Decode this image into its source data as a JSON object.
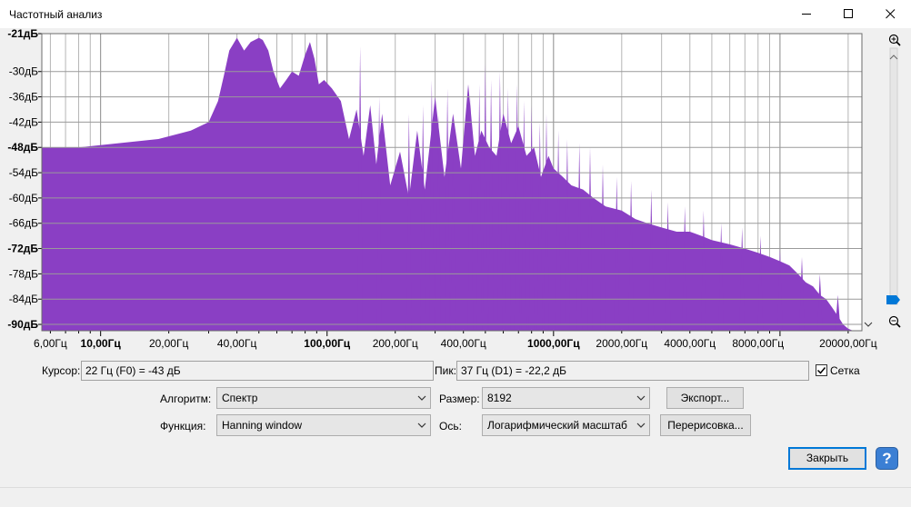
{
  "window": {
    "title": "Частотный анализ"
  },
  "chart_data": {
    "type": "area",
    "title": "",
    "xlabel": "",
    "ylabel": "",
    "x_scale": "log",
    "xlim": [
      5.5,
      23000
    ],
    "ylim": [
      -91.5,
      -21
    ],
    "grid": true,
    "color": "#8a3fc4",
    "y_ticks": [
      {
        "value": -21,
        "label": "-21дБ",
        "bold": true
      },
      {
        "value": -30,
        "label": "-30дБ"
      },
      {
        "value": -36,
        "label": "-36дБ"
      },
      {
        "value": -42,
        "label": "-42дБ"
      },
      {
        "value": -48,
        "label": "-48дБ",
        "bold": true
      },
      {
        "value": -54,
        "label": "-54дБ"
      },
      {
        "value": -60,
        "label": "-60дБ"
      },
      {
        "value": -66,
        "label": "-66дБ"
      },
      {
        "value": -72,
        "label": "-72дБ",
        "bold": true
      },
      {
        "value": -78,
        "label": "-78дБ"
      },
      {
        "value": -84,
        "label": "-84дБ"
      },
      {
        "value": -90,
        "label": "-90дБ",
        "bold": true
      }
    ],
    "x_ticks": [
      {
        "value": 6,
        "label": "6,00Гц"
      },
      {
        "value": 10,
        "label": "10,00Гц",
        "bold": true
      },
      {
        "value": 20,
        "label": "20,00Гц"
      },
      {
        "value": 40,
        "label": "40,00Гц"
      },
      {
        "value": 100,
        "label": "100,00Гц",
        "bold": true
      },
      {
        "value": 200,
        "label": "200,00Гц"
      },
      {
        "value": 400,
        "label": "400,00Гц"
      },
      {
        "value": 1000,
        "label": "1000,00Гц",
        "bold": true
      },
      {
        "value": 2000,
        "label": "2000,00Гц"
      },
      {
        "value": 4000,
        "label": "4000,00Гц"
      },
      {
        "value": 8000,
        "label": "8000,00Гц"
      },
      {
        "value": 20000,
        "label": "20000,00Гц"
      }
    ],
    "x": [
      5.5,
      8,
      12,
      18,
      25,
      30,
      33,
      35,
      37,
      40,
      43,
      46,
      50,
      52,
      55,
      58,
      62,
      66,
      70,
      75,
      80,
      84,
      88,
      92,
      97,
      105,
      115,
      125,
      135,
      145,
      155,
      165,
      175,
      190,
      210,
      230,
      250,
      270,
      300,
      330,
      360,
      390,
      420,
      450,
      480,
      520,
      560,
      600,
      650,
      700,
      760,
      820,
      880,
      950,
      1000,
      1100,
      1200,
      1350,
      1500,
      1700,
      2000,
      2300,
      2600,
      3000,
      3500,
      4000,
      4500,
      5000,
      6000,
      7000,
      8000,
      9000,
      10000,
      11000,
      12000,
      13000,
      14000,
      15000,
      16000,
      17000,
      18000,
      19000,
      20000,
      21000,
      22050
    ],
    "values": [
      -48,
      -48,
      -47,
      -46,
      -44,
      -42,
      -37,
      -31,
      -25,
      -22,
      -25,
      -23,
      -22,
      -22.5,
      -25,
      -30,
      -34,
      -32,
      -30,
      -31,
      -26,
      -23,
      -27,
      -33,
      -32,
      -34,
      -37,
      -46,
      -39,
      -50,
      -38,
      -52,
      -40,
      -57,
      -49,
      -60,
      -44,
      -58,
      -36,
      -55,
      -40,
      -53,
      -33,
      -50,
      -44,
      -48,
      -50,
      -40,
      -47,
      -43,
      -50,
      -48,
      -55,
      -50,
      -53,
      -55,
      -57,
      -58,
      -60,
      -62,
      -63,
      -65,
      -66,
      -67,
      -68,
      -68,
      -69,
      -70,
      -71,
      -72,
      -73,
      -74,
      -75,
      -76,
      -78,
      -80,
      -81,
      -83,
      -84,
      -86,
      -88,
      -90,
      -91,
      -91.5,
      -91.5
    ],
    "peaks": [
      [
        140,
        -24
      ],
      [
        170,
        -36
      ],
      [
        230,
        -40
      ],
      [
        265,
        -38
      ],
      [
        290,
        -32
      ],
      [
        310,
        -40
      ],
      [
        340,
        -34
      ],
      [
        360,
        -45
      ],
      [
        430,
        -36
      ],
      [
        470,
        -33
      ],
      [
        500,
        -28
      ],
      [
        530,
        -32
      ],
      [
        580,
        -30
      ],
      [
        630,
        -34
      ],
      [
        690,
        -33
      ],
      [
        740,
        -37
      ],
      [
        800,
        -38
      ],
      [
        870,
        -42
      ],
      [
        930,
        -40
      ],
      [
        1050,
        -44
      ],
      [
        1150,
        -46
      ],
      [
        1300,
        -47
      ],
      [
        1450,
        -48
      ],
      [
        1650,
        -52
      ],
      [
        1900,
        -55
      ],
      [
        2200,
        -56
      ],
      [
        2700,
        -58
      ],
      [
        3200,
        -61
      ],
      [
        3800,
        -62
      ],
      [
        4600,
        -63
      ],
      [
        5500,
        -66
      ],
      [
        6800,
        -67
      ],
      [
        8200,
        -69
      ],
      [
        10000,
        -72
      ],
      [
        12500,
        -74
      ],
      [
        15000,
        -78
      ],
      [
        18000,
        -83
      ]
    ]
  },
  "controls": {
    "cursor_label": "Курсор:",
    "cursor_value": "22 Гц (F0) = -43 дБ",
    "peak_label": "Пик:",
    "peak_value": "37 Гц (D1) = -22,2 дБ",
    "grid_label": "Сетка",
    "grid_checked": true,
    "algorithm_label": "Алгоритм:",
    "algorithm_value": "Спектр",
    "size_label": "Размер:",
    "size_value": "8192",
    "export_label": "Экспорт...",
    "function_label": "Функция:",
    "function_value": "Hanning window",
    "axis_label": "Ось:",
    "axis_value": "Логарифмический масштаб",
    "redraw_label": "Перерисовка...",
    "close_label": "Закрыть",
    "help_symbol": "?"
  },
  "accent": "#0078d7"
}
